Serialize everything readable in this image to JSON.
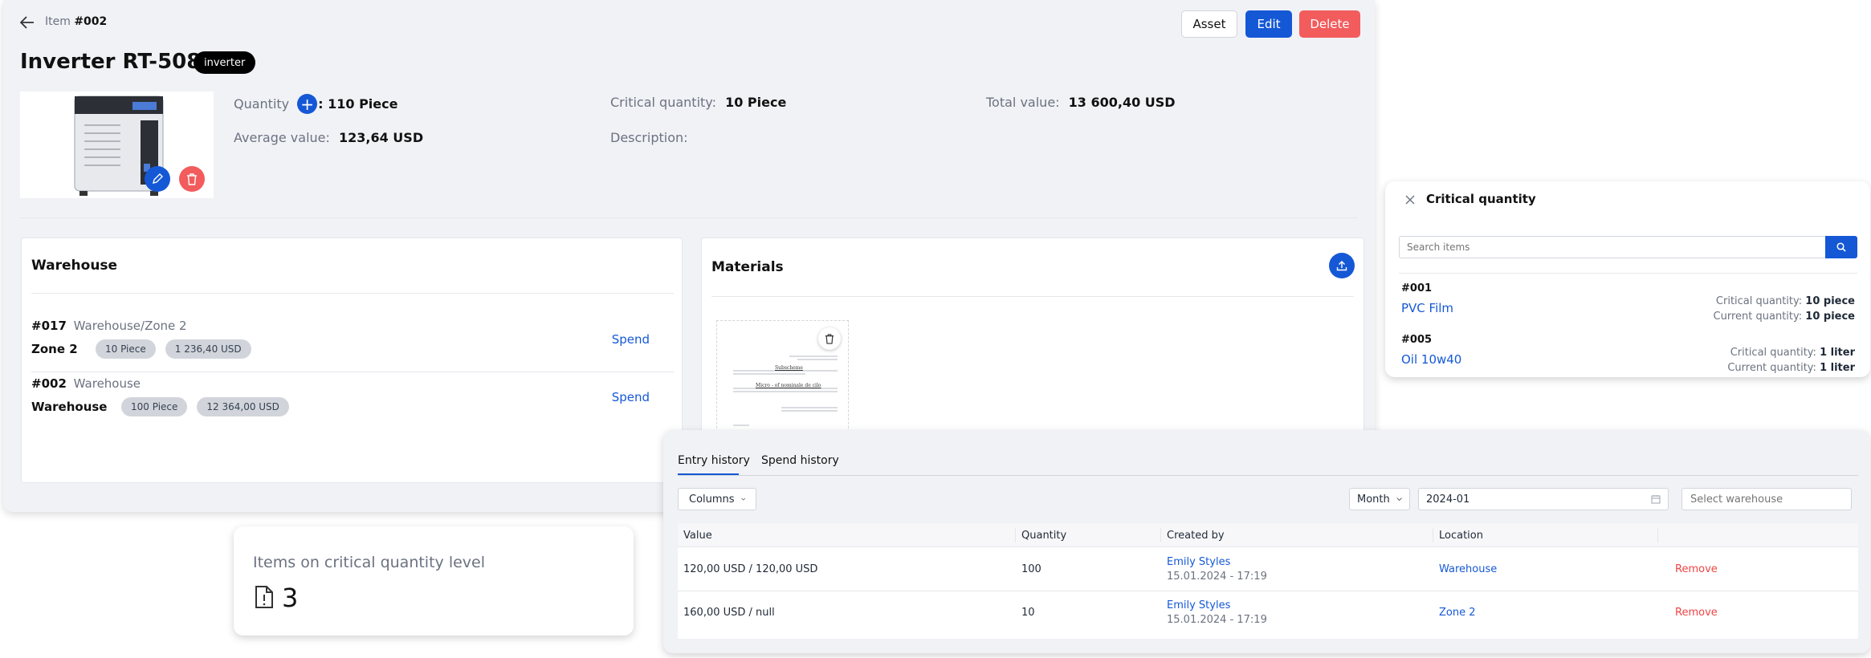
{
  "header": {
    "item_prefix": "Item",
    "item_number": "#002",
    "title": "Inverter RT-508",
    "tag": "inverter",
    "asset_label": "Asset",
    "edit_label": "Edit",
    "delete_label": "Delete"
  },
  "details": {
    "quantity_label": "Quantity",
    "quantity_value": ": 110 Piece",
    "critical_label": "Critical quantity:",
    "critical_value": "10 Piece",
    "total_label": "Total value:",
    "total_value": "13 600,40 USD",
    "average_label": "Average value:",
    "average_value": "123,64 USD",
    "description_label": "Description:"
  },
  "warehouse": {
    "title": "Warehouse",
    "rows": [
      {
        "code": "#017",
        "path": "Warehouse/Zone 2",
        "name": "Zone 2",
        "qty": "10 Piece",
        "value": "1 236,40 USD",
        "action": "Spend"
      },
      {
        "code": "#002",
        "path": "Warehouse",
        "name": "Warehouse",
        "qty": "100 Piece",
        "value": "12 364,00 USD",
        "action": "Spend"
      }
    ]
  },
  "materials": {
    "title": "Materials",
    "doc_heading": "Subscheme",
    "doc_sub": "Micro - of nominale de cilo"
  },
  "critical_panel": {
    "title": "Critical quantity",
    "search_placeholder": "Search items",
    "items": [
      {
        "code": "#001",
        "name": "PVC Film",
        "crit_label": "Critical quantity:",
        "crit_value": "10 piece",
        "curr_label": "Current quantity:",
        "curr_value": "10 piece"
      },
      {
        "code": "#005",
        "name": "Oil 10w40",
        "crit_label": "Critical quantity:",
        "crit_value": "1 liter",
        "curr_label": "Current quantity:",
        "curr_value": "1 liter"
      }
    ]
  },
  "stat": {
    "label": "Items on critical quantity level",
    "value": "3"
  },
  "history": {
    "tabs": [
      "Entry history",
      "Spend history"
    ],
    "columns_button": "Columns",
    "period": "Month",
    "date": "2024-01",
    "warehouse_placeholder": "Select warehouse",
    "headers": [
      "Value",
      "Quantity",
      "Created by",
      "Location"
    ],
    "rows": [
      {
        "value": "120,00 USD / 120,00 USD",
        "qty": "100",
        "user": "Emily Styles",
        "date": "15.01.2024 - 17:19",
        "location": "Warehouse",
        "action": "Remove"
      },
      {
        "value": "160,00 USD / null",
        "qty": "10",
        "user": "Emily Styles",
        "date": "15.01.2024 - 17:19",
        "location": "Zone 2",
        "action": "Remove"
      }
    ]
  },
  "colors": {
    "primary": "#1558d6",
    "danger": "#f25c5c",
    "tag_bg": "#000000"
  }
}
